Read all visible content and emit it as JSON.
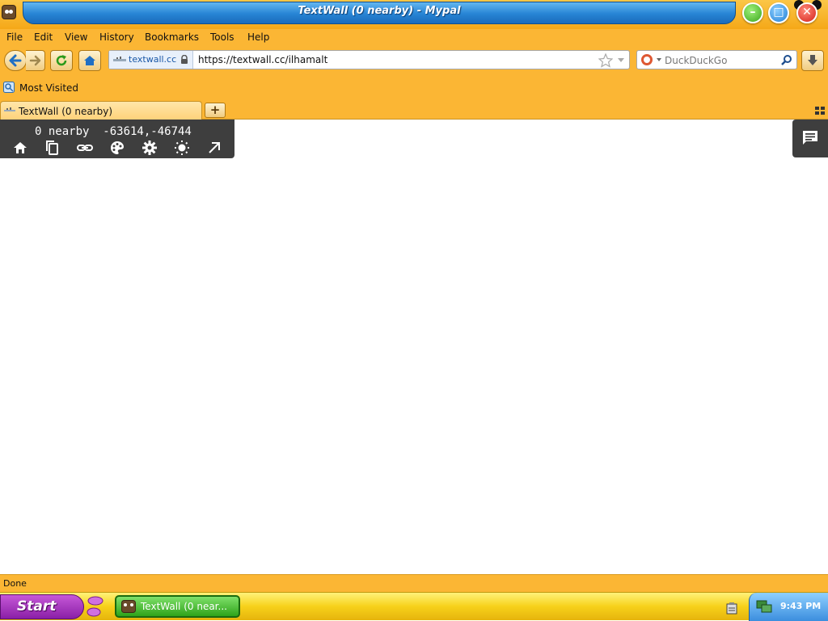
{
  "window": {
    "title": "TextWall (0 nearby) - Mypal"
  },
  "menu": [
    "File",
    "Edit",
    "View",
    "History",
    "Bookmarks",
    "Tools",
    "Help"
  ],
  "navbar": {
    "site_identity": "textwall.cc",
    "url": "https://textwall.cc/ilhamalt",
    "search_placeholder": "DuckDuckGo"
  },
  "bookmarks": [
    {
      "label": "Most Visited"
    }
  ],
  "tabs": [
    {
      "label": "TextWall (0 nearby)",
      "active": true
    }
  ],
  "textwall": {
    "status": "0 nearby  -63614,-46744",
    "toolbar_icons": [
      "home-icon",
      "copy-icon",
      "link-icon",
      "palette-icon",
      "gear-icon",
      "brightness-icon",
      "arrow-up-right-icon"
    ],
    "chat_icon": "chat-icon"
  },
  "statusbar": {
    "text": "Done"
  },
  "taskbar": {
    "start_label": "Start",
    "task_label": "TextWall (0 near...",
    "clock": "9:43 PM"
  },
  "colors": {
    "chrome": "#fbb634",
    "title_bar": "#2784d4",
    "panel": "#3e3e3e",
    "start": "#8a1fa6",
    "task": "#2ea31a"
  }
}
